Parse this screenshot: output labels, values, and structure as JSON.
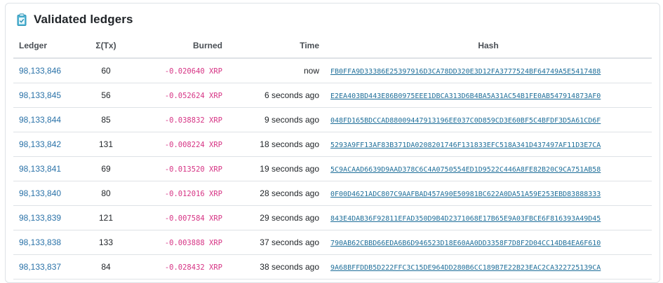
{
  "card": {
    "title": "Validated ledgers",
    "icon": "clipboard-check-icon"
  },
  "table": {
    "headers": {
      "ledger": "Ledger",
      "tx": "Σ(Tx)",
      "burned": "Burned",
      "time": "Time",
      "hash": "Hash"
    },
    "rows": [
      {
        "ledger": "98,133,846",
        "tx": "60",
        "burned": "-0.020640 XRP",
        "time": "now",
        "hash": "FB0FFA9D33386E25397916D3CA78DD320E3D12FA3777524BF64749A5E5417488"
      },
      {
        "ledger": "98,133,845",
        "tx": "56",
        "burned": "-0.052624 XRP",
        "time": "6 seconds ago",
        "hash": "E2EA403BD443E86B0975EEE1DBCA313D6B4BA5A31AC54B1FE0AB547914873AF0"
      },
      {
        "ledger": "98,133,844",
        "tx": "85",
        "burned": "-0.038832 XRP",
        "time": "9 seconds ago",
        "hash": "048FD165BDCCAD88009447913196EE037C0D859CD3E60BF5C4BFDF3D5A61CD6F"
      },
      {
        "ledger": "98,133,842",
        "tx": "131",
        "burned": "-0.008224 XRP",
        "time": "18 seconds ago",
        "hash": "5293A9FF13AF83B371DA0208201746F131833EFC518A341D437497AF11D3E7CA"
      },
      {
        "ledger": "98,133,841",
        "tx": "69",
        "burned": "-0.013520 XRP",
        "time": "19 seconds ago",
        "hash": "5C9ACAAD6639D9AAD378C6C4A0750554ED1D9522C446A8FE82B20C9CA751AB58"
      },
      {
        "ledger": "98,133,840",
        "tx": "80",
        "burned": "-0.012016 XRP",
        "time": "28 seconds ago",
        "hash": "0F00D4621ADC807C9AAFBAD457A90E50981BC622A0DA51A59E253EBD83888333"
      },
      {
        "ledger": "98,133,839",
        "tx": "121",
        "burned": "-0.007584 XRP",
        "time": "29 seconds ago",
        "hash": "843E4DAB36F92811EFAD350D9B4D2371068E17B65E9A03FBCE6F816393A49D45"
      },
      {
        "ledger": "98,133,838",
        "tx": "133",
        "burned": "-0.003888 XRP",
        "time": "37 seconds ago",
        "hash": "790AB62CBBD66EDA6B6D946523D18E60AA0DD3358F7D8F2D04CC14DB4EA6F610"
      },
      {
        "ledger": "98,133,837",
        "tx": "84",
        "burned": "-0.028432 XRP",
        "time": "38 seconds ago",
        "hash": "9A68BFFDDB5D222FFC3C15DE964DD280B6CC189B7E22B23EAC2CA322725139CA"
      }
    ]
  },
  "colors": {
    "link": "#2a72a8",
    "burned": "#d63384",
    "hash": "#1f6f9a",
    "border": "#dee2e6"
  }
}
